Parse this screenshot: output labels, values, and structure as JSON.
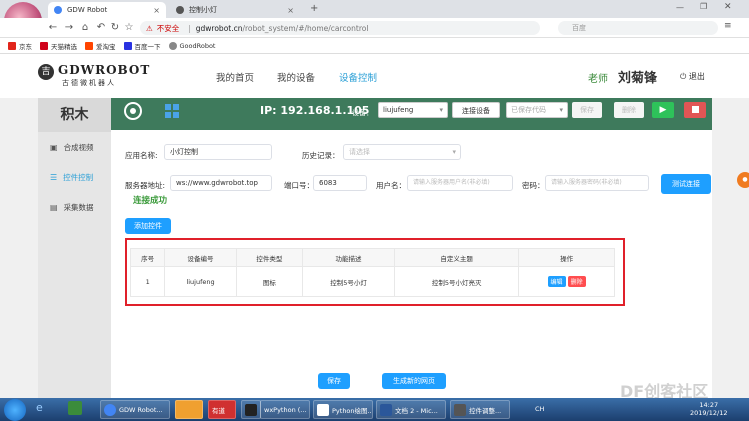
{
  "browser": {
    "tabs": [
      {
        "label": "GDW Robot"
      },
      {
        "label": "控制小灯"
      }
    ],
    "new_tab": "+",
    "url_warning": "不安全",
    "url_host": "gdwrobot.cn",
    "url_path": "/robot_system/#/home/carcontrol",
    "search_placeholder": "百度",
    "bookmarks": [
      "京东",
      "天猫精选",
      "爱淘宝",
      "百度一下",
      "GoodRobot"
    ]
  },
  "site": {
    "logo_text": "GDWROBOT",
    "logo_sub": "古德微机器人",
    "nav": [
      "我的首页",
      "我的设备",
      "设备控制"
    ],
    "teacher_role": "老师",
    "teacher_name": "刘菊锋",
    "logout": "退出"
  },
  "sidebar": {
    "title": "积木",
    "items": [
      {
        "label": "合成视频"
      },
      {
        "label": "控件控制"
      },
      {
        "label": "采集数据"
      }
    ]
  },
  "toolbar": {
    "ip": "IP: 192.168.1.105",
    "device_label": "设备：",
    "device_value": "liujufeng",
    "connect_button": "连接设备",
    "saved_code_placeholder": "已保存代码",
    "save_button": "保存",
    "delete_button": "删除"
  },
  "form": {
    "app_name_label": "应用名称:",
    "app_name_value": "小灯控制",
    "history_label": "历史记录：",
    "history_placeholder": "请选择",
    "server_label": "服务器地址:",
    "server_value": "ws://www.gdwrobot.top",
    "port_label": "端口号：",
    "port_value": "6083",
    "username_label": "用户名：",
    "username_placeholder": "请输入服务器用户名(非必填)",
    "password_label": "密码：",
    "password_placeholder": "请输入服务器密码(非必填)",
    "test_button": "测试连接",
    "status": "连接成功",
    "add_control_button": "添加控件"
  },
  "table": {
    "headers": [
      "序号",
      "设备编号",
      "控件类型",
      "功能描述",
      "自定义主题",
      "操作"
    ],
    "rows": [
      {
        "index": "1",
        "device": "liujufeng",
        "type": "图标",
        "desc": "控制5号小灯",
        "topic": "控制5号小灯亮灭",
        "edit": "编辑",
        "delete": "删除"
      }
    ]
  },
  "footer_buttons": {
    "save": "保存",
    "generate": "生成新的网页"
  },
  "taskbar": {
    "items": [
      "GDW Robot...",
      "",
      "有道",
      "",
      "wxPython (...",
      "Python绘图...",
      "文档 2 - Mic...",
      "控件调整..."
    ],
    "lang": "CH",
    "time": "14:27",
    "date": "2019/12/12"
  },
  "watermark": "DF创客社区"
}
